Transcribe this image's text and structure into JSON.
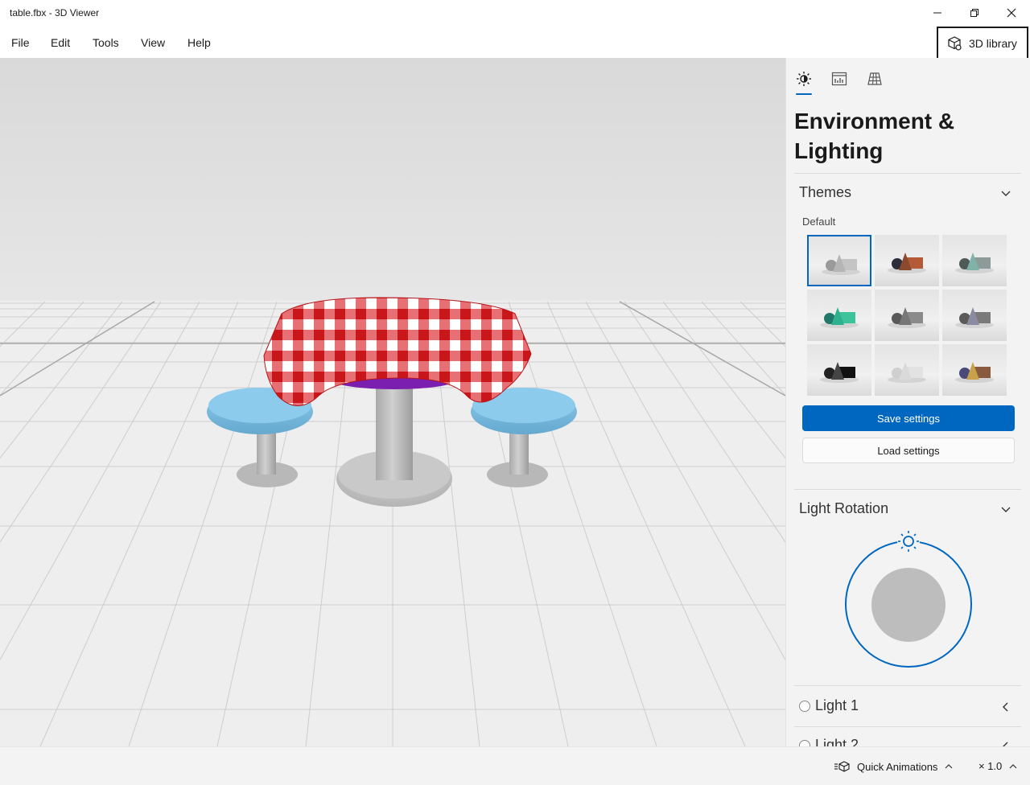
{
  "window": {
    "title": "table.fbx - 3D Viewer",
    "minimize_icon": "minimize-icon",
    "maximize_icon": "restore-icon",
    "close_icon": "close-icon"
  },
  "menu": {
    "items": [
      "File",
      "Edit",
      "Tools",
      "View",
      "Help"
    ],
    "library_button": "3D library"
  },
  "panel": {
    "tabs": [
      "environment-lighting-icon",
      "stats-shading-icon",
      "grid-views-icon"
    ],
    "title": "Environment & Lighting",
    "themes": {
      "heading": "Themes",
      "group_label": "Default",
      "selected_index": 0,
      "swatches": [
        {
          "name": "theme-1",
          "colors": [
            "#9a9a9a",
            "#b5b5b5",
            "#c4c4c4"
          ]
        },
        {
          "name": "theme-2",
          "colors": [
            "#2e2e3a",
            "#8b4a2e",
            "#b55a36"
          ]
        },
        {
          "name": "theme-3",
          "colors": [
            "#4e5a58",
            "#7fb3a8",
            "#8c9a98"
          ]
        },
        {
          "name": "theme-4",
          "colors": [
            "#1f7a6a",
            "#2fb08e",
            "#3cc39c"
          ]
        },
        {
          "name": "theme-5",
          "colors": [
            "#5a5a5a",
            "#777777",
            "#8a8a8a"
          ]
        },
        {
          "name": "theme-6",
          "colors": [
            "#5a5a5a",
            "#8a8aa0",
            "#7a7a7a"
          ]
        },
        {
          "name": "theme-7",
          "colors": [
            "#222222",
            "#444444",
            "#111111"
          ]
        },
        {
          "name": "theme-8",
          "colors": [
            "#cfcfcf",
            "#dadada",
            "#e2e2e2"
          ]
        },
        {
          "name": "theme-9",
          "colors": [
            "#4a4a7a",
            "#c7a24a",
            "#8a5a3e"
          ]
        }
      ]
    },
    "save_button": "Save settings",
    "load_button": "Load settings",
    "light_rotation": {
      "heading": "Light Rotation"
    },
    "lights": [
      "Light 1",
      "Light 2"
    ]
  },
  "status": {
    "animations_label": "Quick Animations",
    "speed_label": "× 1.0"
  },
  "colors": {
    "accent": "#0067c0",
    "tablecloth_red": "#d8262a",
    "stool_blue": "#7bbde0",
    "table_gray": "#c8c8c8",
    "underside_purple": "#7a1fb0"
  }
}
